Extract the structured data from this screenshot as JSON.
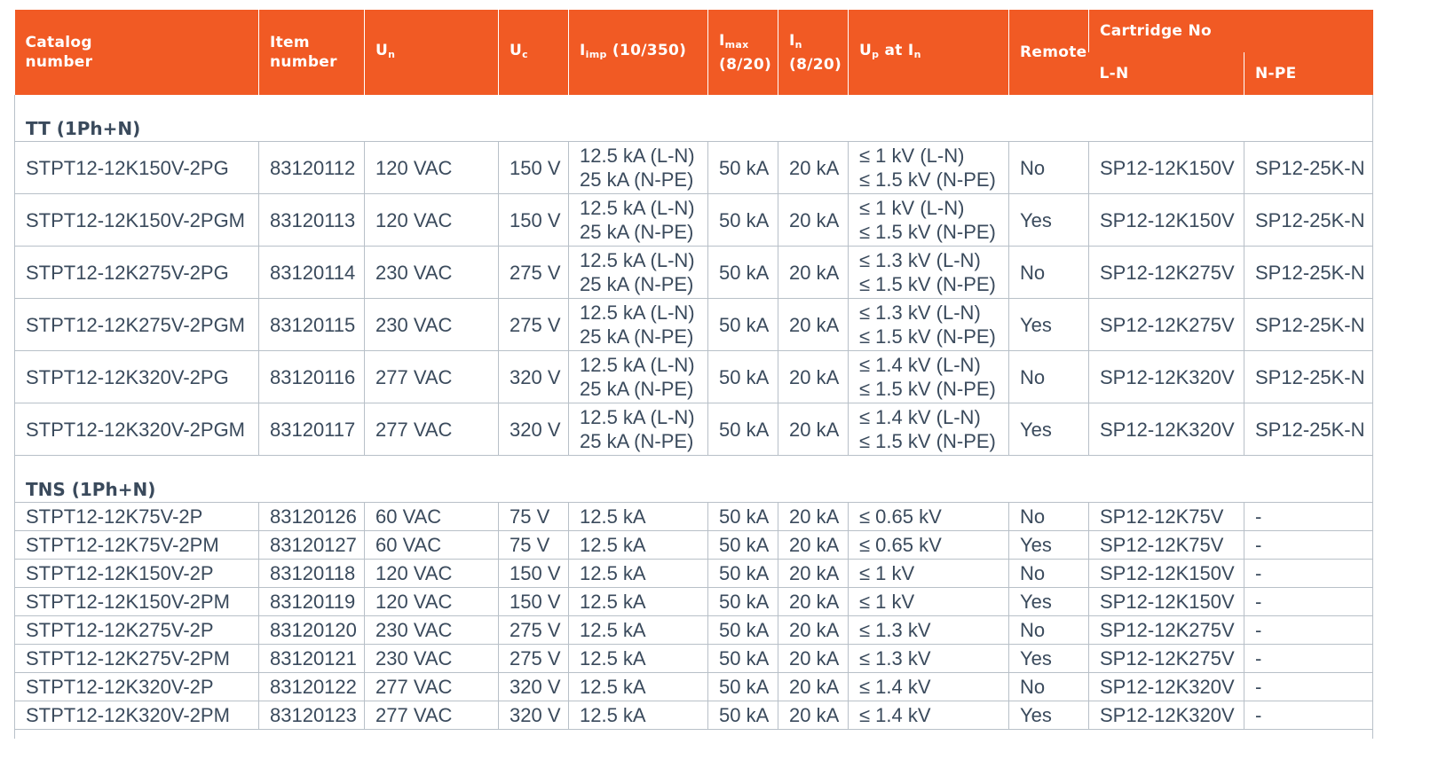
{
  "header": {
    "catalog": [
      "Catalog",
      "number"
    ],
    "item": [
      "Item",
      "number"
    ],
    "un": {
      "main": "U",
      "sub": "n"
    },
    "uc": {
      "main": "U",
      "sub": "c"
    },
    "iimp": {
      "main": "I",
      "sub": "imp",
      "rest": " (10/350)"
    },
    "imax": {
      "main": "I",
      "sub": "max",
      "rest": "(8/20)"
    },
    "in": {
      "main": "I",
      "sub": "n",
      "rest": "(8/20)"
    },
    "up": {
      "main": "U",
      "sub": "p",
      "mid": " at I",
      "sub2": "n"
    },
    "remote": "Remote",
    "cartridge": "Cartridge No",
    "ln": "L-N",
    "npe": "N-PE"
  },
  "sections": [
    {
      "title": "TT (1Ph+N)",
      "rows": [
        {
          "catalog": "STPT12-12K150V-2PG",
          "item": "83120112",
          "un": "120 VAC",
          "uc": "150 V",
          "iimp": [
            "12.5 kA (L-N)",
            "25 kA (N-PE)"
          ],
          "imax": "50 kA",
          "in": "20 kA",
          "up": [
            "≤ 1 kV (L-N)",
            "≤ 1.5 kV (N-PE)"
          ],
          "remote": "No",
          "ln": "SP12-12K150V",
          "npe": "SP12-25K-N"
        },
        {
          "catalog": "STPT12-12K150V-2PGM",
          "item": "83120113",
          "un": "120 VAC",
          "uc": "150 V",
          "iimp": [
            "12.5 kA (L-N)",
            "25 kA (N-PE)"
          ],
          "imax": "50 kA",
          "in": "20 kA",
          "up": [
            "≤ 1 kV (L-N)",
            "≤ 1.5 kV (N-PE)"
          ],
          "remote": "Yes",
          "ln": "SP12-12K150V",
          "npe": "SP12-25K-N"
        },
        {
          "catalog": "STPT12-12K275V-2PG",
          "item": "83120114",
          "un": "230 VAC",
          "uc": "275 V",
          "iimp": [
            "12.5 kA (L-N)",
            "25 kA (N-PE)"
          ],
          "imax": "50 kA",
          "in": "20 kA",
          "up": [
            "≤ 1.3 kV (L-N)",
            "≤ 1.5 kV (N-PE)"
          ],
          "remote": "No",
          "ln": "SP12-12K275V",
          "npe": "SP12-25K-N"
        },
        {
          "catalog": "STPT12-12K275V-2PGM",
          "item": "83120115",
          "un": "230 VAC",
          "uc": "275 V",
          "iimp": [
            "12.5 kA (L-N)",
            "25 kA (N-PE)"
          ],
          "imax": "50 kA",
          "in": "20 kA",
          "up": [
            "≤ 1.3 kV (L-N)",
            "≤ 1.5 kV (N-PE)"
          ],
          "remote": "Yes",
          "ln": "SP12-12K275V",
          "npe": "SP12-25K-N"
        },
        {
          "catalog": "STPT12-12K320V-2PG",
          "item": "83120116",
          "un": "277 VAC",
          "uc": "320 V",
          "iimp": [
            "12.5 kA (L-N)",
            "25 kA (N-PE)"
          ],
          "imax": "50 kA",
          "in": "20 kA",
          "up": [
            "≤ 1.4 kV (L-N)",
            "≤ 1.5 kV (N-PE)"
          ],
          "remote": "No",
          "ln": "SP12-12K320V",
          "npe": "SP12-25K-N"
        },
        {
          "catalog": "STPT12-12K320V-2PGM",
          "item": "83120117",
          "un": "277 VAC",
          "uc": "320 V",
          "iimp": [
            "12.5 kA (L-N)",
            "25 kA (N-PE)"
          ],
          "imax": "50 kA",
          "in": "20 kA",
          "up": [
            "≤ 1.4 kV (L-N)",
            "≤ 1.5 kV (N-PE)"
          ],
          "remote": "Yes",
          "ln": "SP12-12K320V",
          "npe": "SP12-25K-N"
        }
      ]
    },
    {
      "title": "TNS (1Ph+N)",
      "rows": [
        {
          "catalog": "STPT12-12K75V-2P",
          "item": "83120126",
          "un": "60 VAC",
          "uc": "75 V",
          "iimp": [
            "12.5 kA"
          ],
          "imax": "50 kA",
          "in": "20 kA",
          "up": [
            "≤ 0.65 kV"
          ],
          "remote": "No",
          "ln": "SP12-12K75V",
          "npe": "-"
        },
        {
          "catalog": "STPT12-12K75V-2PM",
          "item": "83120127",
          "un": "60 VAC",
          "uc": "75 V",
          "iimp": [
            "12.5 kA"
          ],
          "imax": "50 kA",
          "in": "20 kA",
          "up": [
            "≤ 0.65 kV"
          ],
          "remote": "Yes",
          "ln": "SP12-12K75V",
          "npe": "-"
        },
        {
          "catalog": "STPT12-12K150V-2P",
          "item": "83120118",
          "un": "120 VAC",
          "uc": "150 V",
          "iimp": [
            "12.5 kA"
          ],
          "imax": "50 kA",
          "in": "20 kA",
          "up": [
            "≤ 1 kV"
          ],
          "remote": "No",
          "ln": "SP12-12K150V",
          "npe": "-"
        },
        {
          "catalog": "STPT12-12K150V-2PM",
          "item": "83120119",
          "un": "120 VAC",
          "uc": "150 V",
          "iimp": [
            "12.5 kA"
          ],
          "imax": "50 kA",
          "in": "20 kA",
          "up": [
            "≤ 1 kV"
          ],
          "remote": "Yes",
          "ln": "SP12-12K150V",
          "npe": "-"
        },
        {
          "catalog": "STPT12-12K275V-2P",
          "item": "83120120",
          "un": "230 VAC",
          "uc": "275 V",
          "iimp": [
            "12.5 kA"
          ],
          "imax": "50 kA",
          "in": "20 kA",
          "up": [
            "≤ 1.3 kV"
          ],
          "remote": "No",
          "ln": "SP12-12K275V",
          "npe": "-"
        },
        {
          "catalog": "STPT12-12K275V-2PM",
          "item": "83120121",
          "un": "230 VAC",
          "uc": "275 V",
          "iimp": [
            "12.5 kA"
          ],
          "imax": "50 kA",
          "in": "20 kA",
          "up": [
            "≤ 1.3 kV"
          ],
          "remote": "Yes",
          "ln": "SP12-12K275V",
          "npe": "-"
        },
        {
          "catalog": "STPT12-12K320V-2P",
          "item": "83120122",
          "un": "277 VAC",
          "uc": "320 V",
          "iimp": [
            "12.5 kA"
          ],
          "imax": "50 kA",
          "in": "20 kA",
          "up": [
            "≤ 1.4 kV"
          ],
          "remote": "No",
          "ln": "SP12-12K320V",
          "npe": "-"
        },
        {
          "catalog": "STPT12-12K320V-2PM",
          "item": "83120123",
          "un": "277 VAC",
          "uc": "320 V",
          "iimp": [
            "12.5 kA"
          ],
          "imax": "50 kA",
          "in": "20 kA",
          "up": [
            "≤ 1.4 kV"
          ],
          "remote": "Yes",
          "ln": "SP12-12K320V",
          "npe": "-"
        }
      ]
    }
  ],
  "colors": {
    "header_bg": "#f15a24",
    "header_text": "#ffffff",
    "border": "#b8c0c8",
    "text": "#3a4a5c"
  }
}
